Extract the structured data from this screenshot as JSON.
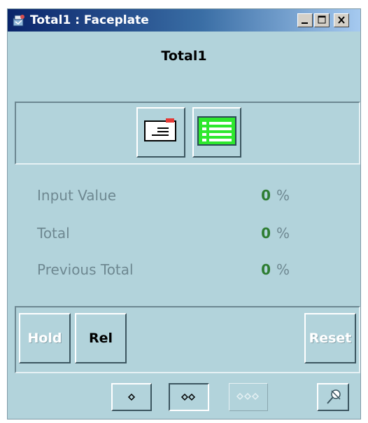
{
  "window": {
    "title": "Total1 : Faceplate",
    "controls": [
      "minimize-icon",
      "maximize-icon",
      "close-icon"
    ]
  },
  "faceplate": {
    "title": "Total1"
  },
  "toolbar": {
    "buttons": [
      {
        "icon": "message-icon",
        "accent": "#e53935"
      },
      {
        "icon": "trend-table-icon",
        "accent": "#2ee82e"
      }
    ]
  },
  "measurements": [
    {
      "label": "Input Value",
      "value": "0",
      "unit": "%"
    },
    {
      "label": "Total",
      "value": "0",
      "unit": "%"
    },
    {
      "label": "Previous Total",
      "value": "0",
      "unit": "%"
    }
  ],
  "commands": {
    "hold": {
      "label": "Hold",
      "enabled": false
    },
    "rel": {
      "label": "Rel",
      "enabled": true
    },
    "reset": {
      "label": "Reset",
      "enabled": false
    }
  },
  "view_modes": [
    {
      "icon": "single-diamond-icon",
      "selected": false,
      "enabled": true
    },
    {
      "icon": "double-diamond-icon",
      "selected": true,
      "enabled": true
    },
    {
      "icon": "triple-diamond-icon",
      "selected": false,
      "enabled": false
    }
  ],
  "pin": {
    "icon": "pin-icon"
  },
  "colors": {
    "background": "#b2d3db",
    "value_green": "#2e7d32",
    "label_gray": "#6e8891"
  }
}
